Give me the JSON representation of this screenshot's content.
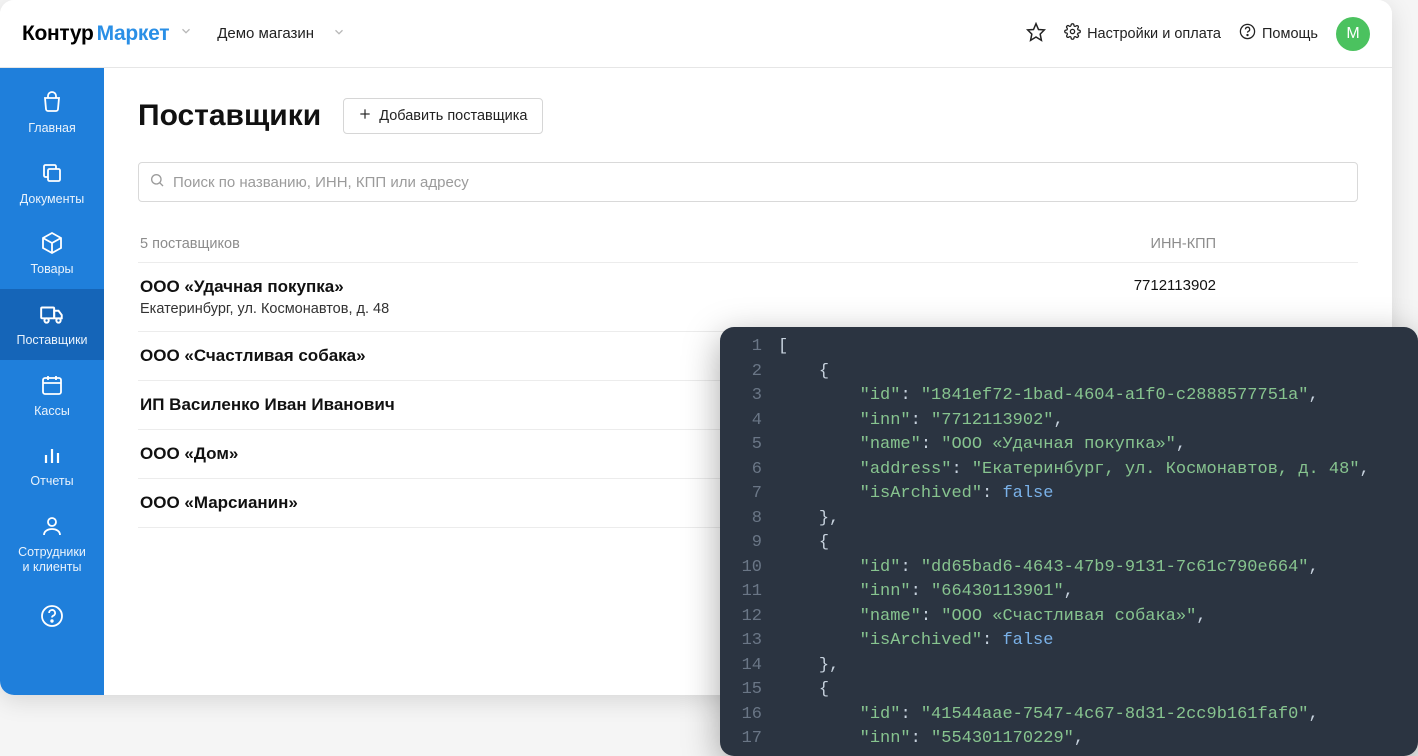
{
  "header": {
    "logo_part1": "Контур",
    "logo_part2": "Маркет",
    "shop_name": "Демо магазин",
    "settings_label": "Настройки и оплата",
    "help_label": "Помощь",
    "avatar_letter": "М"
  },
  "sidebar": {
    "items": [
      {
        "label": "Главная"
      },
      {
        "label": "Документы"
      },
      {
        "label": "Товары"
      },
      {
        "label": "Поставщики"
      },
      {
        "label": "Кассы"
      },
      {
        "label": "Отчеты"
      },
      {
        "label": "Сотрудники\nи клиенты"
      }
    ]
  },
  "page": {
    "title": "Поставщики",
    "add_button": "Добавить поставщика",
    "search_placeholder": "Поиск по названию, ИНН, КПП или адресу",
    "count_label": "5 поставщиков",
    "inn_col_label": "ИНН-КПП",
    "rows": [
      {
        "name": "ООО «Удачная покупка»",
        "address": "Екатеринбург, ул. Космонавтов, д. 48",
        "inn": "7712113902"
      },
      {
        "name": "ООО «Счастливая собака»",
        "address": "",
        "inn": ""
      },
      {
        "name": "ИП Василенко Иван Иванович",
        "address": "",
        "inn": ""
      },
      {
        "name": "ООО «Дом»",
        "address": "",
        "inn": ""
      },
      {
        "name": "ООО «Марсианин»",
        "address": "",
        "inn": ""
      }
    ]
  },
  "code": {
    "lines": [
      {
        "n": "1",
        "indent": 0,
        "tokens": [
          [
            "punc",
            "["
          ]
        ]
      },
      {
        "n": "2",
        "indent": 1,
        "tokens": [
          [
            "punc",
            "{"
          ]
        ]
      },
      {
        "n": "3",
        "indent": 2,
        "tokens": [
          [
            "key",
            "\"id\""
          ],
          [
            "punc",
            ": "
          ],
          [
            "str",
            "\"1841ef72-1bad-4604-a1f0-c2888577751a\""
          ],
          [
            "punc",
            ","
          ]
        ]
      },
      {
        "n": "4",
        "indent": 2,
        "tokens": [
          [
            "key",
            "\"inn\""
          ],
          [
            "punc",
            ": "
          ],
          [
            "str",
            "\"7712113902\""
          ],
          [
            "punc",
            ","
          ]
        ]
      },
      {
        "n": "5",
        "indent": 2,
        "tokens": [
          [
            "key",
            "\"name\""
          ],
          [
            "punc",
            ": "
          ],
          [
            "str",
            "\"ООО «Удачная покупка»\""
          ],
          [
            "punc",
            ","
          ]
        ]
      },
      {
        "n": "6",
        "indent": 2,
        "tokens": [
          [
            "key",
            "\"address\""
          ],
          [
            "punc",
            ": "
          ],
          [
            "str",
            "\"Екатеринбург, ул. Космонавтов, д. 48\""
          ],
          [
            "punc",
            ","
          ]
        ]
      },
      {
        "n": "7",
        "indent": 2,
        "tokens": [
          [
            "key",
            "\"isArchived\""
          ],
          [
            "punc",
            ": "
          ],
          [
            "bool",
            "false"
          ]
        ]
      },
      {
        "n": "8",
        "indent": 1,
        "tokens": [
          [
            "punc",
            "},"
          ]
        ]
      },
      {
        "n": "9",
        "indent": 1,
        "tokens": [
          [
            "punc",
            "{"
          ]
        ]
      },
      {
        "n": "10",
        "indent": 2,
        "tokens": [
          [
            "key",
            "\"id\""
          ],
          [
            "punc",
            ": "
          ],
          [
            "str",
            "\"dd65bad6-4643-47b9-9131-7c61c790e664\""
          ],
          [
            "punc",
            ","
          ]
        ]
      },
      {
        "n": "11",
        "indent": 2,
        "tokens": [
          [
            "key",
            "\"inn\""
          ],
          [
            "punc",
            ": "
          ],
          [
            "str",
            "\"66430113901\""
          ],
          [
            "punc",
            ","
          ]
        ]
      },
      {
        "n": "12",
        "indent": 2,
        "tokens": [
          [
            "key",
            "\"name\""
          ],
          [
            "punc",
            ": "
          ],
          [
            "str",
            "\"ООО «Счастливая собака»\""
          ],
          [
            "punc",
            ","
          ]
        ]
      },
      {
        "n": "13",
        "indent": 2,
        "tokens": [
          [
            "key",
            "\"isArchived\""
          ],
          [
            "punc",
            ": "
          ],
          [
            "bool",
            "false"
          ]
        ]
      },
      {
        "n": "14",
        "indent": 1,
        "tokens": [
          [
            "punc",
            "},"
          ]
        ]
      },
      {
        "n": "15",
        "indent": 1,
        "tokens": [
          [
            "punc",
            "{"
          ]
        ]
      },
      {
        "n": "16",
        "indent": 2,
        "tokens": [
          [
            "key",
            "\"id\""
          ],
          [
            "punc",
            ": "
          ],
          [
            "str",
            "\"41544aae-7547-4c67-8d31-2cc9b161faf0\""
          ],
          [
            "punc",
            ","
          ]
        ]
      },
      {
        "n": "17",
        "indent": 2,
        "tokens": [
          [
            "key",
            "\"inn\""
          ],
          [
            "punc",
            ": "
          ],
          [
            "str",
            "\"554301170229\""
          ],
          [
            "punc",
            ","
          ]
        ]
      }
    ]
  }
}
